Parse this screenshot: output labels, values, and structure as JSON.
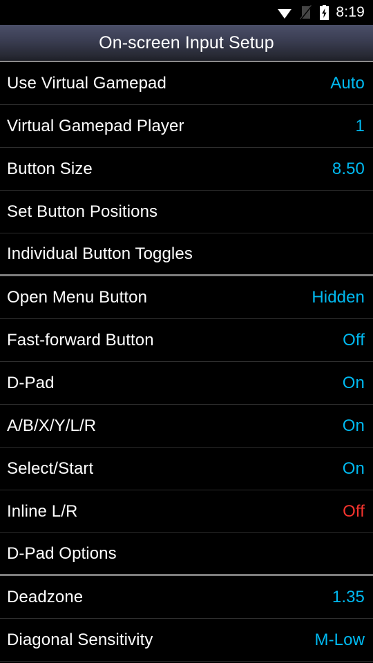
{
  "status_bar": {
    "clock": "8:19",
    "icons": [
      {
        "name": "wifi-icon",
        "label": "wifi"
      },
      {
        "name": "no-sim-icon",
        "label": "no signal"
      },
      {
        "name": "battery-charging-icon",
        "label": "battery charging"
      }
    ]
  },
  "title_bar": {
    "title": "On-screen Input Setup"
  },
  "colors": {
    "accent": "#00b9f0",
    "warn": "#f6342e",
    "background": "#000000",
    "divider": "#2e2e2e",
    "section_divider": "#7d7d7d",
    "title_gradient_top": "#4b4f69",
    "title_gradient_bottom": "#1d1e26"
  },
  "settings": [
    {
      "label": "Use Virtual Gamepad",
      "value": "Auto",
      "value_style": "accent",
      "section_end": false
    },
    {
      "label": "Virtual Gamepad Player",
      "value": "1",
      "value_style": "accent",
      "section_end": false
    },
    {
      "label": "Button Size",
      "value": "8.50",
      "value_style": "accent",
      "section_end": false
    },
    {
      "label": "Set Button Positions",
      "value": "",
      "value_style": "empty",
      "section_end": false
    },
    {
      "label": "Individual Button Toggles",
      "value": "",
      "value_style": "empty",
      "section_end": true
    },
    {
      "label": "Open Menu Button",
      "value": "Hidden",
      "value_style": "accent",
      "section_end": false
    },
    {
      "label": "Fast-forward Button",
      "value": "Off",
      "value_style": "accent",
      "section_end": false
    },
    {
      "label": "D-Pad",
      "value": "On",
      "value_style": "accent",
      "section_end": false
    },
    {
      "label": "A/B/X/Y/L/R",
      "value": "On",
      "value_style": "accent",
      "section_end": false
    },
    {
      "label": "Select/Start",
      "value": "On",
      "value_style": "accent",
      "section_end": false
    },
    {
      "label": "Inline L/R",
      "value": "Off",
      "value_style": "warn",
      "section_end": false
    },
    {
      "label": "D-Pad Options",
      "value": "",
      "value_style": "empty",
      "section_end": true
    },
    {
      "label": "Deadzone",
      "value": "1.35",
      "value_style": "accent",
      "section_end": false
    },
    {
      "label": "Diagonal Sensitivity",
      "value": "M-Low",
      "value_style": "accent",
      "section_end": false
    }
  ]
}
